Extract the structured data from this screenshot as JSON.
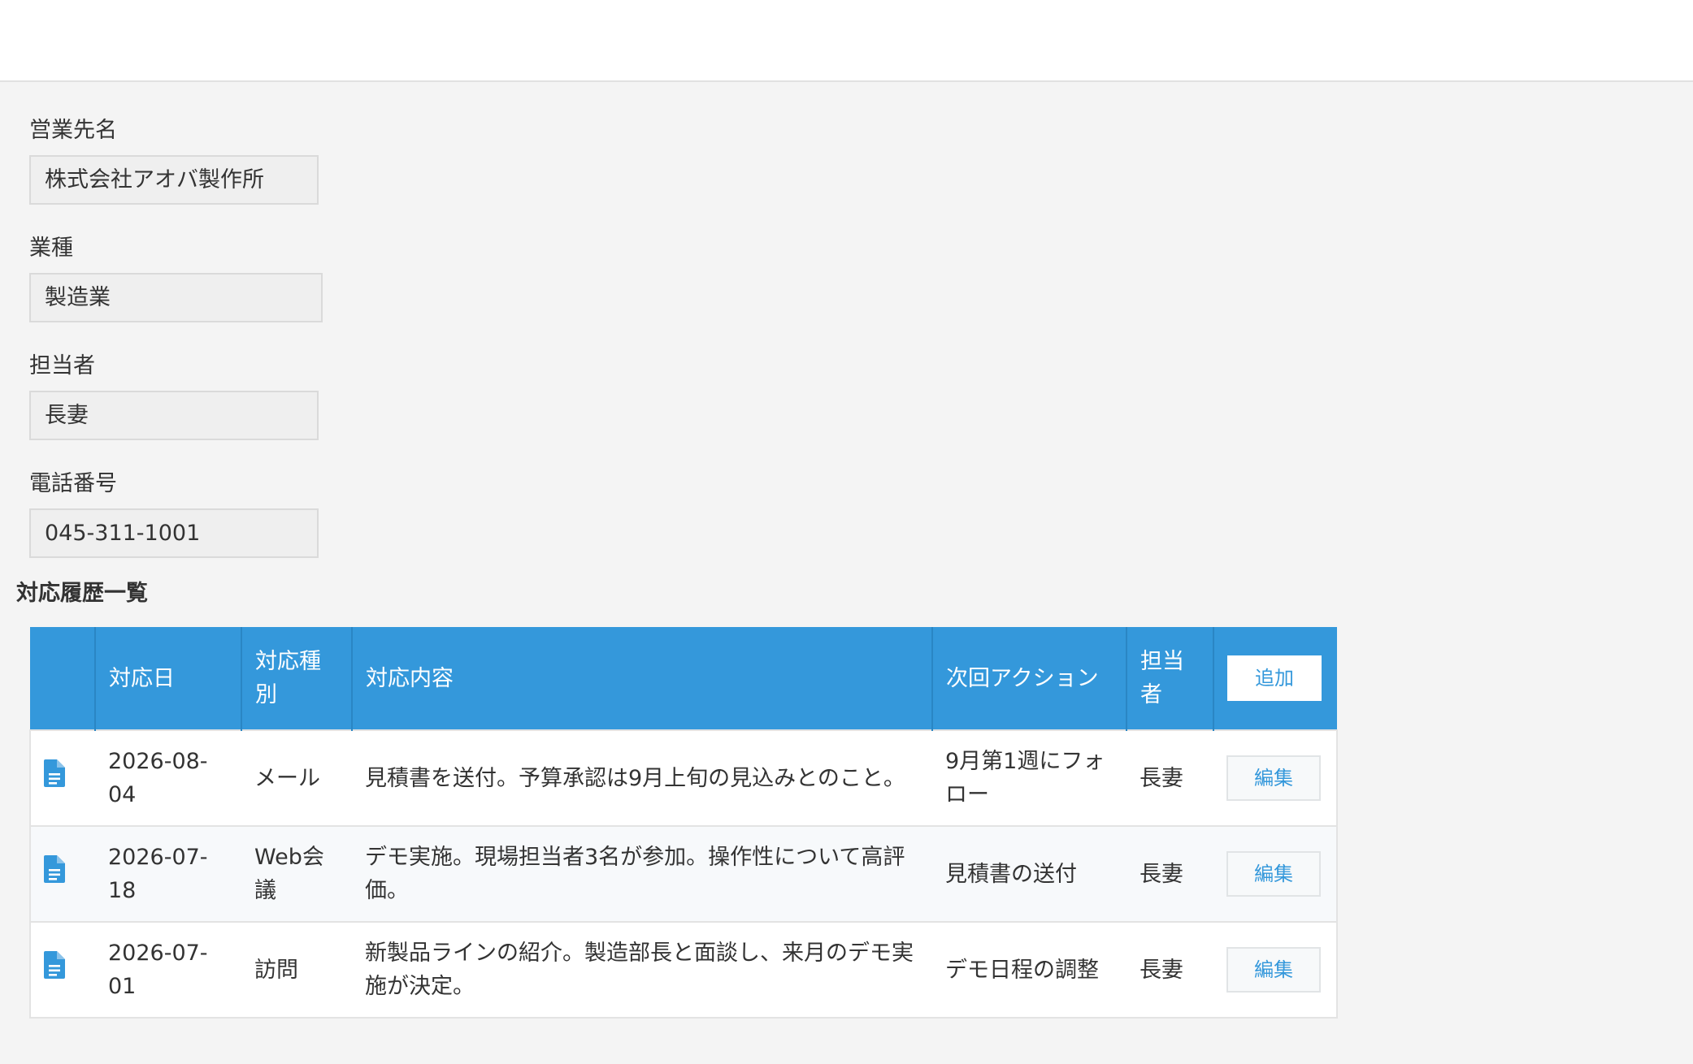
{
  "form": {
    "company": {
      "label": "営業先名",
      "value": "株式会社アオバ製作所"
    },
    "industry": {
      "label": "業種",
      "value": "製造業"
    },
    "owner": {
      "label": "担当者",
      "value": "長妻"
    },
    "phone": {
      "label": "電話番号",
      "value": "045-311-1001"
    }
  },
  "history": {
    "title": "対応履歴一覧",
    "columns": {
      "date": "対応日",
      "type": "対応種別",
      "content": "対応内容",
      "next_action": "次回アクション",
      "owner": "担当者"
    },
    "add_label": "追加",
    "edit_label": "編集",
    "icon": "document-icon",
    "accent_color": "#3498db",
    "rows": [
      {
        "date": "2026-08-04",
        "type": "メール",
        "content": "見積書を送付。予算承認は9月上旬の見込みとのこと。",
        "next_action": "9月第1週にフォロー",
        "owner": "長妻"
      },
      {
        "date": "2026-07-18",
        "type": "Web会議",
        "content": "デモ実施。現場担当者3名が参加。操作性について高評価。",
        "next_action": "見積書の送付",
        "owner": "長妻"
      },
      {
        "date": "2026-07-01",
        "type": "訪問",
        "content": "新製品ラインの紹介。製造部長と面談し、来月のデモ実施が決定。",
        "next_action": "デモ日程の調整",
        "owner": "長妻"
      }
    ]
  }
}
